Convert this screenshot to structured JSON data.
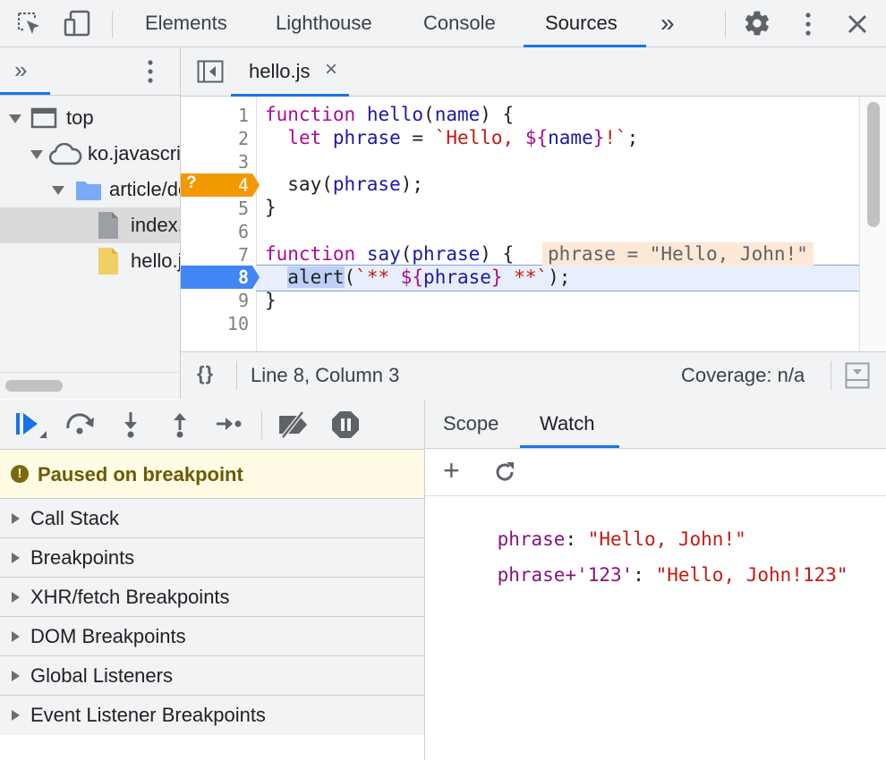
{
  "toolbar": {
    "tabs": [
      {
        "label": "Elements"
      },
      {
        "label": "Lighthouse"
      },
      {
        "label": "Console"
      },
      {
        "label": "Sources"
      }
    ],
    "more_label": "»"
  },
  "navigator": {
    "tree": [
      {
        "label": "top"
      },
      {
        "label": "ko.javascript.info"
      },
      {
        "label": "article/debugging-chrome"
      },
      {
        "label": "index.html"
      },
      {
        "label": "hello.js"
      }
    ]
  },
  "editor": {
    "open_tab": "hello.js",
    "close_glyph": "×",
    "breakpoint_marker": "?",
    "line_numbers": [
      "1",
      "2",
      "3",
      "4",
      "5",
      "6",
      "7",
      "8",
      "9",
      "10"
    ],
    "inline_value": "phrase = \"Hello, John!\"",
    "status": {
      "format_glyph": "{}",
      "position": "Line 8, Column 3",
      "coverage": "Coverage: n/a"
    }
  },
  "debugger": {
    "paused_message": "Paused on breakpoint",
    "info_glyph": "!",
    "sections": [
      {
        "label": "Call Stack"
      },
      {
        "label": "Breakpoints"
      },
      {
        "label": "XHR/fetch Breakpoints"
      },
      {
        "label": "DOM Breakpoints"
      },
      {
        "label": "Global Listeners"
      },
      {
        "label": "Event Listener Breakpoints"
      }
    ]
  },
  "sidebar": {
    "tabs": [
      {
        "label": "Scope"
      },
      {
        "label": "Watch"
      }
    ],
    "add_glyph": "+",
    "watch": [
      {
        "expr": "phrase",
        "value": "\"Hello, John!\""
      },
      {
        "expr": "phrase+'123'",
        "value": "\"Hello, John!123\""
      }
    ]
  },
  "colors": {
    "accent": "#1a73e8",
    "breakpoint_conditional": "#f29900",
    "execution_line": "#e8eefb",
    "paused_banner": "#fffbe5"
  }
}
